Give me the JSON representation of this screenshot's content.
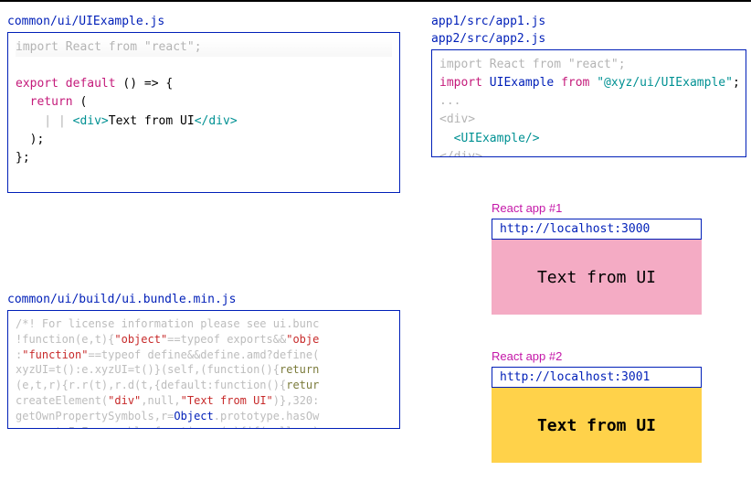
{
  "leftCode1": {
    "path": "common/ui/UIExample.js",
    "line1": {
      "import": "import",
      "react": "React",
      "from": "from",
      "str": "\"react\"",
      "semi": ";"
    },
    "line2": {
      "export": "export",
      "default": "default",
      "rest": " () => {"
    },
    "line3": {
      "return": "return",
      "paren": " ("
    },
    "line4": {
      "pipes": "    | | ",
      "open": "<div>",
      "text": "Text from UI",
      "close": "</div>"
    },
    "line5": "  );",
    "line6": "};"
  },
  "leftCode2": {
    "path": "common/ui/build/ui.bundle.min.js",
    "l1": "/*! For license information please see ui.bunc",
    "l2a": "!function(e,t){",
    "l2b": "\"object\"",
    "l2c": "==typeof exports&&",
    "l2d": "\"obje",
    "l3a": ":",
    "l3b": "\"function\"",
    "l3c": "==typeof define&&define.amd?define(",
    "l4a": "xyzUI=t():e.xyzUI=t()}(self,(function(){",
    "l4b": "return",
    "l5a": "(e,t,r){r.r(t),r.d(t,{default:function(){",
    "l5b": "retur",
    "l6a": "createElement(",
    "l6b": "\"div\"",
    "l6c": ",null,",
    "l6d": "\"Text from UI\"",
    "l6e": ")},320:",
    "l7a": "getOwnPropertySymbols,r=",
    "l7b": "Object",
    "l7c": ".prototype.hasOw",
    "l8": "propertyIsEnumerable;function n(e){if(null==e)"
  },
  "rightCode": {
    "path1": "app1/src/app1.js",
    "path2": "app2/src/app2.js",
    "l1": {
      "import": "import",
      "react": "React",
      "from": "from",
      "str": "\"react\"",
      "semi": ";"
    },
    "l2": {
      "import": "import",
      "name": "UIExample",
      "from": "from",
      "str": "\"@xyz/ui/UIExample\"",
      "semi": ";"
    },
    "l3": "...",
    "l4": "<div>",
    "l5": "  <UIExample/>",
    "l6": "</div>"
  },
  "app1": {
    "label": "React app #1",
    "url": "http://localhost:3000",
    "text": "Text from UI"
  },
  "app2": {
    "label": "React app #2",
    "url": "http://localhost:3001",
    "text": "Text from UI"
  }
}
